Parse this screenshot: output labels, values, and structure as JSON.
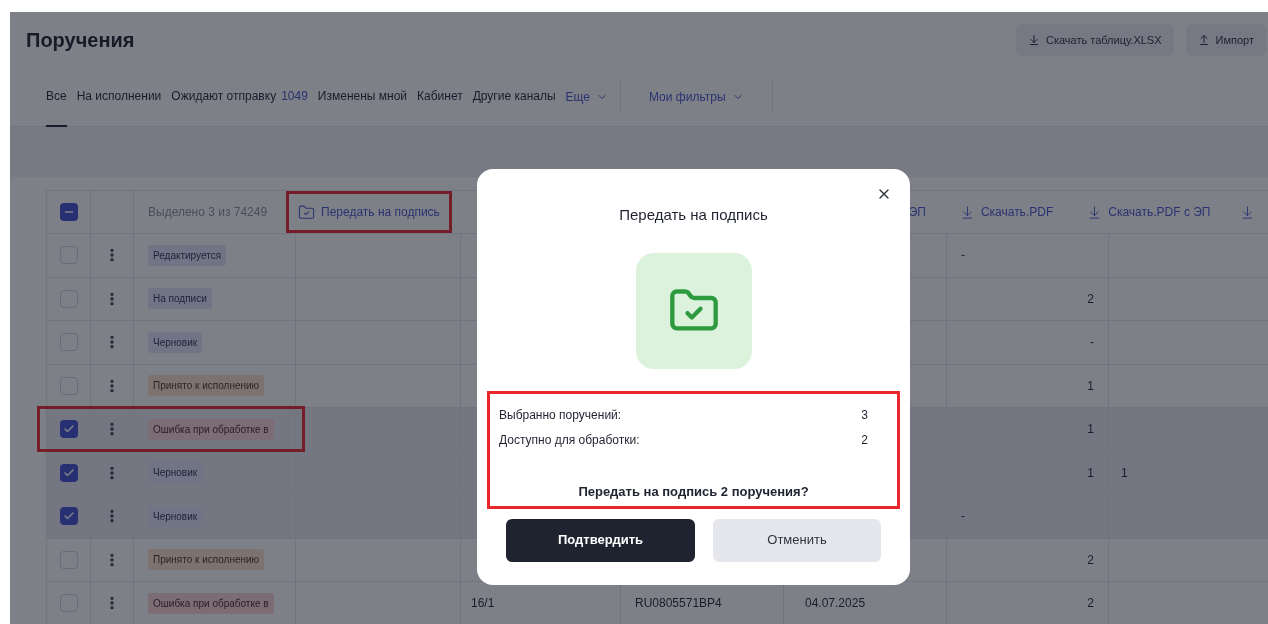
{
  "page": {
    "title": "Поручения",
    "actions": [
      {
        "label": "Скачать таблицу.XLSX",
        "kind": "download"
      },
      {
        "label": "Импорт",
        "kind": "upload"
      }
    ]
  },
  "tabs": [
    {
      "label": "Все",
      "selected": true
    },
    {
      "label": "На исполнении",
      "selected": false
    },
    {
      "label": "Ожидают отправку",
      "count": "1049",
      "selected": false
    },
    {
      "label": "Изменены мной",
      "selected": false
    },
    {
      "label": "Кабинет",
      "selected": false
    },
    {
      "label": "Другие каналы",
      "selected": false
    }
  ],
  "more_tab": "Еще",
  "filters": "Мои фильтры",
  "table": {
    "header": {
      "all_checked": true,
      "indeterminate": true,
      "selection_count": "Выделено 3 из 74249",
      "sign_action": {
        "label": "Передать на подпись",
        "highlighted": true
      },
      "column_7_tail": "ЭП",
      "downloads": [
        "Скачать.PDF",
        "Скачать.PDF с ЭП"
      ]
    },
    "rows": [
      {
        "checked": false,
        "highlighted": false,
        "status": "Редактируется",
        "kind": "neutral",
        "column_8_start": "-"
      },
      {
        "checked": false,
        "highlighted": false,
        "status": "На подписи",
        "kind": "neutral",
        "column_8_end": "2"
      },
      {
        "checked": false,
        "highlighted": false,
        "status": "Черновик",
        "kind": "neutral",
        "column_8_end": "-"
      },
      {
        "checked": false,
        "highlighted": false,
        "status": "Принято к исполнению",
        "kind": "accepted",
        "column_8_end": "1"
      },
      {
        "checked": true,
        "highlighted": true,
        "status": "Ошибка при обработке в",
        "kind": "error",
        "column_8_end": "1"
      },
      {
        "checked": true,
        "highlighted": false,
        "status": "Черновик",
        "kind": "neutral",
        "column_8_end": "1",
        "column_9": "1"
      },
      {
        "checked": true,
        "highlighted": false,
        "status": "Черновик",
        "kind": "neutral",
        "column_8_start": "-"
      },
      {
        "checked": false,
        "highlighted": false,
        "status": "Принято к исполнению",
        "kind": "accepted",
        "column_8_end": "2"
      },
      {
        "checked": false,
        "highlighted": false,
        "status": "Ошибка при обработке в",
        "kind": "error",
        "column_5": "16/1",
        "column_6": "RU0805571BP4",
        "column_7": "04.07.2025",
        "column_8_end": "2"
      }
    ]
  },
  "dialog": {
    "title": "Передать на подпись",
    "info_highlighted": true,
    "stats": [
      {
        "label": "Выбранно поручений:",
        "value": "3"
      },
      {
        "label": "Доступно для обработки:",
        "value": "2"
      }
    ],
    "question": "Передать на подпись 2 поручения?",
    "confirm": "Подтвердить",
    "cancel": "Отменить"
  }
}
